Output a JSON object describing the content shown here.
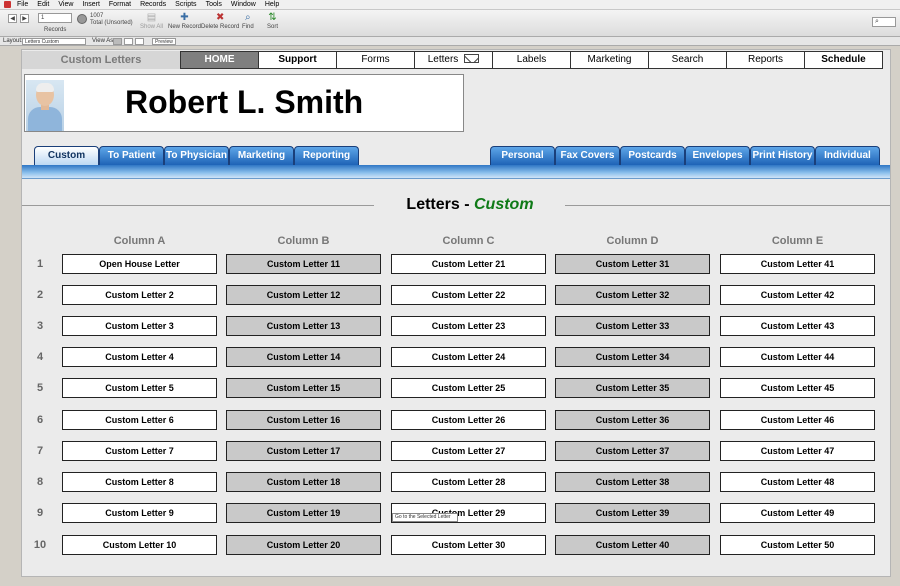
{
  "menu": [
    "File",
    "Edit",
    "View",
    "Insert",
    "Format",
    "Records",
    "Scripts",
    "Tools",
    "Window",
    "Help"
  ],
  "toolbar": {
    "record_value": "1",
    "record_total": "1007",
    "record_status": "Total (Unsorted)",
    "records_label": "Records",
    "show_all": "Show All",
    "new_record": "New Record",
    "delete_record": "Delete Record",
    "find": "Find",
    "sort": "Sort",
    "search_placeholder": ""
  },
  "layoutbar": {
    "layout_label": "Layout:",
    "layout_value": "Letters Custom",
    "view_as_label": "View As:",
    "preview_label": "Preview"
  },
  "nav": {
    "title": "Custom Letters",
    "items": [
      "HOME",
      "Support",
      "Forms",
      "Letters",
      "Labels",
      "Marketing",
      "Search",
      "Reports",
      "Schedule"
    ]
  },
  "contact": {
    "name": "Robert L. Smith"
  },
  "tabs_left": [
    "Custom",
    "To Patient",
    "To Physician",
    "Marketing",
    "Reporting"
  ],
  "tabs_right": [
    "Personal",
    "Fax Covers",
    "Postcards",
    "Envelopes",
    "Print History",
    "Individual"
  ],
  "section": {
    "title": "Letters -",
    "accent": "Custom"
  },
  "columns": [
    "Column A",
    "Column B",
    "Column C",
    "Column D",
    "Column E"
  ],
  "rows": [
    "1",
    "2",
    "3",
    "4",
    "5",
    "6",
    "7",
    "8",
    "9",
    "10"
  ],
  "letters": [
    [
      "Open House Letter",
      "Custom Letter 2",
      "Custom Letter 3",
      "Custom Letter 4",
      "Custom Letter 5",
      "Custom Letter 6",
      "Custom Letter 7",
      "Custom Letter 8",
      "Custom Letter 9",
      "Custom Letter 10"
    ],
    [
      "Custom Letter 11",
      "Custom Letter 12",
      "Custom Letter 13",
      "Custom Letter 14",
      "Custom Letter 15",
      "Custom Letter 16",
      "Custom Letter 17",
      "Custom Letter 18",
      "Custom Letter 19",
      "Custom Letter 20"
    ],
    [
      "Custom Letter 21",
      "Custom Letter 22",
      "Custom Letter 23",
      "Custom Letter 24",
      "Custom Letter 25",
      "Custom Letter 26",
      "Custom Letter 27",
      "Custom Letter 28",
      "Custom Letter 29",
      "Custom Letter 30"
    ],
    [
      "Custom Letter 31",
      "Custom Letter 32",
      "Custom Letter 33",
      "Custom Letter 34",
      "Custom Letter 35",
      "Custom Letter 36",
      "Custom Letter 37",
      "Custom Letter 38",
      "Custom Letter 39",
      "Custom Letter 40"
    ],
    [
      "Custom Letter 41",
      "Custom Letter 42",
      "Custom Letter 43",
      "Custom Letter 44",
      "Custom Letter 45",
      "Custom Letter 46",
      "Custom Letter 47",
      "Custom Letter 48",
      "Custom Letter 49",
      "Custom Letter 50"
    ]
  ],
  "tooltip": "Go to the Selected Letter",
  "colors": {
    "tab_blue": "#1e63b6",
    "accent_green": "#0f7a17",
    "alt_button": "#c9c9c9",
    "home_button": "#7f7f7f"
  }
}
